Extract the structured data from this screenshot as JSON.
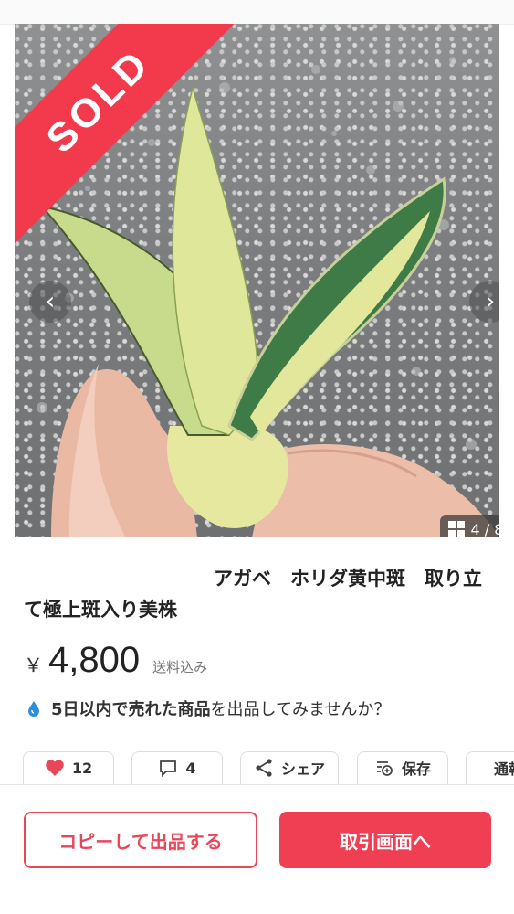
{
  "listing": {
    "sold_label": "SOLD",
    "image_counter": "4 / 8",
    "title": "アガベ　ホリダ黄中斑　取り立て極上斑入り美株",
    "currency": "￥",
    "price": "4,800",
    "shipping": "送料込み"
  },
  "promo": {
    "highlight": "5日以内で売れた商品",
    "rest": "を出品してみませんか？"
  },
  "actions": {
    "likes_count": "12",
    "comments_count": "4",
    "share_label": "シェア",
    "save_label": "保存",
    "report_label": "通報"
  },
  "bottom": {
    "copy_button": "コピーして出品する",
    "trade_button": "取引画面へ"
  },
  "colors": {
    "accent": "#f03e52",
    "sold_ribbon": "#f23a4c"
  },
  "icons": [
    "chevron-left-icon",
    "chevron-right-icon",
    "gallery-grid-icon",
    "water-drop-icon",
    "heart-icon",
    "comment-icon",
    "share-icon",
    "save-icon"
  ]
}
